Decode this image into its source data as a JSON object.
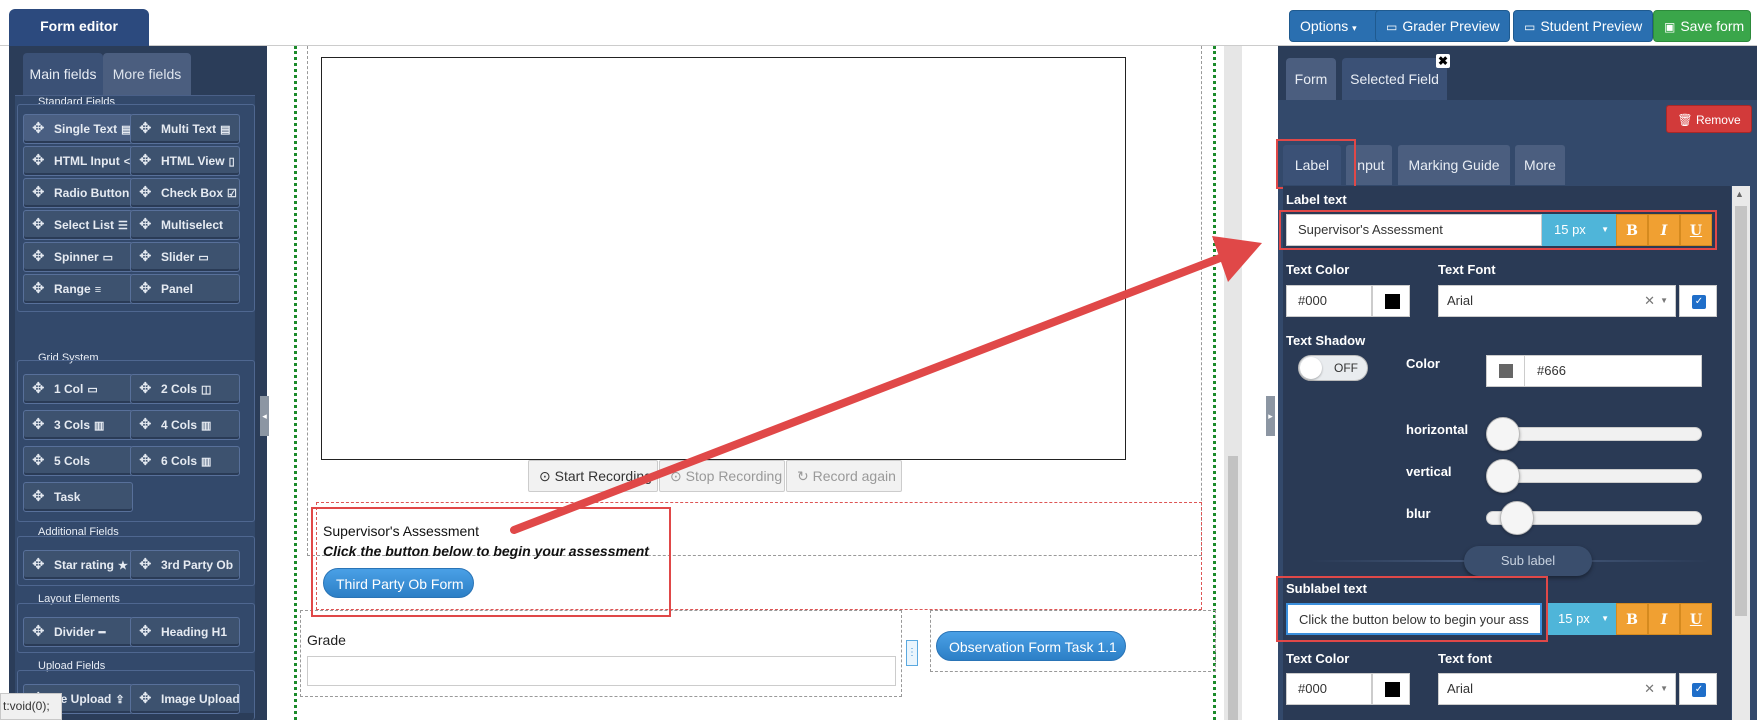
{
  "header": {
    "brand_tab": "Form editor",
    "options_label": "Options",
    "grader_preview_label": "Grader Preview",
    "student_preview_label": "Student Preview",
    "save_label": "Save form"
  },
  "left_panel": {
    "tabs": {
      "main": "Main fields",
      "more": "More fields"
    },
    "standard_fields": {
      "title": "Standard Fields",
      "items": [
        "Single Text",
        "Multi Text",
        "HTML Input",
        "HTML View",
        "Radio Button",
        "Check Box",
        "Select List",
        "Multiselect",
        "Spinner",
        "Slider",
        "Range",
        "Panel"
      ]
    },
    "grid_system": {
      "title": "Grid System",
      "items": [
        "1 Col",
        "2 Cols",
        "3 Cols",
        "4 Cols",
        "5 Cols",
        "6 Cols",
        "Task"
      ]
    },
    "additional_fields": {
      "title": "Additional Fields",
      "items": [
        "Star rating",
        "3rd Party Ob"
      ]
    },
    "layout_elements": {
      "title": "Layout Elements",
      "items": [
        "Divider",
        "Heading H1"
      ]
    },
    "upload_fields": {
      "title": "Upload Fields",
      "items": [
        "ile Upload",
        "Image Upload"
      ]
    }
  },
  "canvas": {
    "recording": {
      "start": "Start Recording",
      "stop": "Stop Recording",
      "again": "Record again"
    },
    "assessment": {
      "title": "Supervisor's Assessment",
      "subtitle": "Click the button below to begin your assessment",
      "button": "Third Party Ob Form"
    },
    "grade_label": "Grade",
    "observation_button": "Observation Form Task 1.1",
    "status_tip": "t:void(0);"
  },
  "right_panel": {
    "tabs": {
      "form": "Form",
      "selected": "Selected Field"
    },
    "remove_label": "Remove",
    "sub_tabs": {
      "label": "Label",
      "input": "Input",
      "guide": "Marking Guide",
      "more": "More"
    },
    "label_section": {
      "title": "Label text",
      "value": "Supervisor's Assessment",
      "size": "15 px",
      "text_color_label": "Text Color",
      "text_color": "#000",
      "text_font_label": "Text Font",
      "text_font": "Arial"
    },
    "shadow": {
      "title": "Text Shadow",
      "toggle": "OFF",
      "color_label": "Color",
      "color_value": "#666",
      "horizontal_label": "horizontal",
      "vertical_label": "vertical",
      "blur_label": "blur"
    },
    "sub_label_separator": "Sub label",
    "sublabel_section": {
      "title": "Sublabel text",
      "value": "Click the button below to begin your ass",
      "size": "15 px",
      "text_color_label": "Text Color",
      "text_color": "#000",
      "text_font_label": "Text font",
      "text_font": "Arial"
    },
    "format_buttons": {
      "bold": "B",
      "italic": "I",
      "underline": "U"
    }
  },
  "colors": {
    "panel_bg": "#2b3d59",
    "primary_btn": "#2a6fb0",
    "save_btn": "#3aa64a",
    "remove_btn": "#d23a3a",
    "annotation": "#e04848"
  }
}
